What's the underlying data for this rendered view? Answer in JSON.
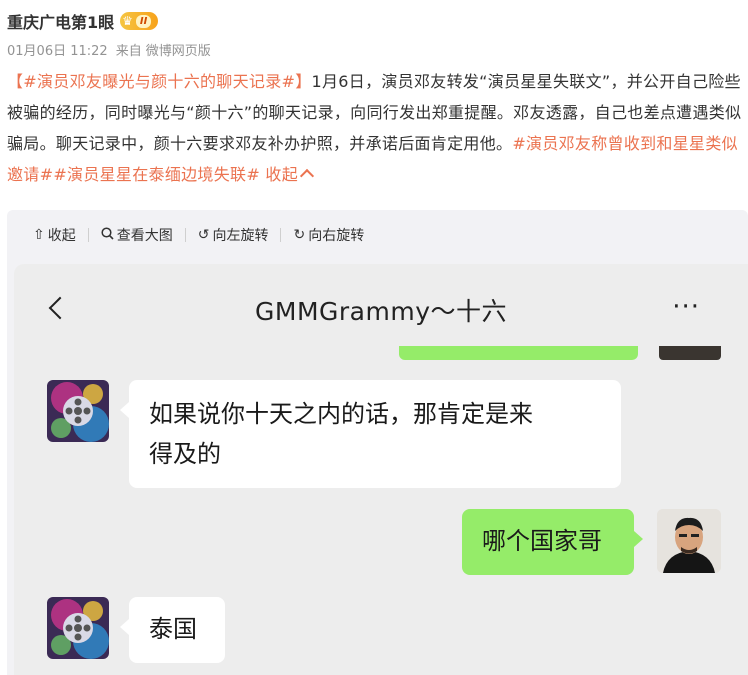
{
  "post": {
    "author": "重庆广电第1眼",
    "vip_level": "II",
    "date": "01月06日 11:22",
    "source_prefix": "来自",
    "source": "微博网页版",
    "text_segments": [
      {
        "kind": "tag",
        "text": "【#演员邓友曝光与颜十六的聊天记录#】"
      },
      {
        "kind": "text",
        "text": "1月6日，演员邓友转发“演员星星失联文”，并公开自己险些被骗的经历，同时曝光与“颜十六”的聊天记录，向同行发出郑重提醒。邓友透露，自己也差点遭遇类似骗局。聊天记录中，颜十六要求邓友补办护照，并承诺后面肯定用他。"
      },
      {
        "kind": "tag",
        "text": "#演员邓友称曾收到和星星类似邀请#"
      },
      {
        "kind": "tag",
        "text": "#演员星星在泰缅边境失联#"
      }
    ],
    "collapse_label": "收起"
  },
  "viewer": {
    "toolbar": {
      "collapse": "收起",
      "view_large": "查看大图",
      "rotate_left": "向左旋转",
      "rotate_right": "向右旋转"
    }
  },
  "chat": {
    "title": "GMMGrammy～十六",
    "more": "···",
    "messages": [
      {
        "side": "in",
        "text_lines": [
          "如果说你十天之内的话，那肯定是来",
          "得及的"
        ]
      },
      {
        "side": "out",
        "text_lines": [
          "哪个国家哥"
        ]
      },
      {
        "side": "in",
        "text_lines": [
          "泰国"
        ]
      }
    ]
  },
  "colors": {
    "accent": "#eb7350",
    "bubble_out": "#95ec69",
    "bubble_in": "#ffffff",
    "chat_bg": "#ededed",
    "viewer_bg": "#f2f2f5",
    "vip_badge": "#f7a21b"
  }
}
